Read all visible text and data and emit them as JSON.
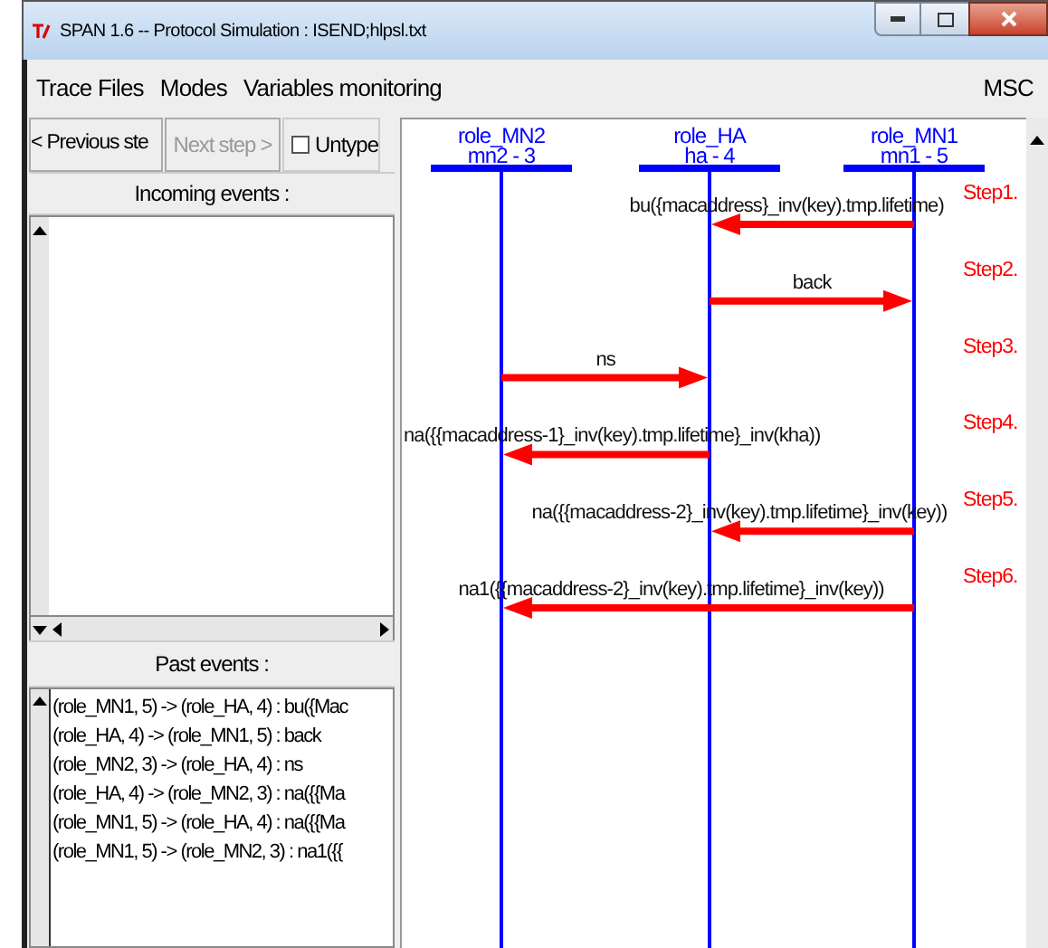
{
  "window": {
    "title": "SPAN 1.6 -- Protocol Simulation : ISEND;hlpsl.txt"
  },
  "menu": {
    "items": [
      "Trace Files",
      "Modes",
      "Variables monitoring"
    ],
    "right": "MSC"
  },
  "toolbar": {
    "previous": {
      "label": "< Previous ste",
      "disabled": false
    },
    "next": {
      "label": "Next step >",
      "disabled": true
    },
    "untype": {
      "label": "Untype",
      "checked": false
    }
  },
  "incoming_events": {
    "label": "Incoming events :"
  },
  "past_events": {
    "label": "Past events :",
    "items": [
      "(role_MN1, 5) -> (role_HA, 4) : bu({Mac",
      "(role_HA, 4) -> (role_MN1, 5) : back",
      "(role_MN2, 3) -> (role_HA, 4) : ns",
      "(role_HA, 4) -> (role_MN2, 3) : na({{Ma",
      "(role_MN1, 5) -> (role_HA, 4) : na({{Ma",
      "(role_MN1, 5) -> (role_MN2, 3) : na1({{"
    ]
  },
  "diagram": {
    "participants": [
      {
        "name": "role_MN2",
        "id": "mn2 - 3"
      },
      {
        "name": "role_HA",
        "id": "ha - 4"
      },
      {
        "name": "role_MN1",
        "id": "mn1 - 5"
      }
    ],
    "messages": [
      {
        "step": "Step1.",
        "label": "bu({macaddress}_inv(key).tmp.lifetime)",
        "kind": "right_to_middle"
      },
      {
        "step": "Step2.",
        "label": "back",
        "kind": "middle_to_right"
      },
      {
        "step": "Step3.",
        "label": "ns",
        "kind": "left_to_middle"
      },
      {
        "step": "Step4.",
        "label": "na({{macaddress-1}_inv(key).tmp.lifetime}_inv(kha))",
        "kind": "middle_to_left"
      },
      {
        "step": "Step5.",
        "label": "na({{macaddress-2}_inv(key).tmp.lifetime}_inv(key))",
        "kind": "right_to_middle"
      },
      {
        "step": "Step6.",
        "label": "na1({{macaddress-2}_inv(key).tmp.lifetime}_inv(key))",
        "kind": "right_to_left"
      }
    ]
  }
}
